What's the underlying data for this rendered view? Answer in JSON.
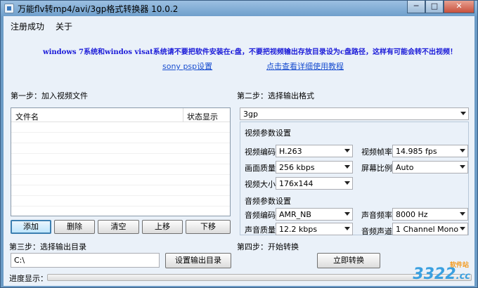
{
  "window": {
    "title": "万能flv转mp4/avi/3gp格式转换器 10.0.2",
    "minimize": "─",
    "maximize": "□",
    "close": "✕"
  },
  "menu": [
    "注册成功",
    "关于"
  ],
  "notice": "windows 7系统和windos visat系统请不要把软件安装在c盘，不要把视频输出存放目录设为c盘路径，这样有可能会转不出视频！",
  "links": {
    "sony": "sony psp设置",
    "help": "点击查看详细使用教程"
  },
  "step1": {
    "title": "第一步：加入视频文件",
    "col_name": "文件名",
    "col_status": "状态显示",
    "buttons": {
      "add": "添加",
      "delete": "删除",
      "clear": "清空",
      "up": "上移",
      "down": "下移"
    }
  },
  "step2": {
    "title": "第二步：选择输出格式",
    "format": "3gp",
    "video": {
      "title": "视频参数设置",
      "codec_label": "视频编码",
      "codec": "H.263",
      "fps_label": "视频帧率",
      "fps": "14.985 fps",
      "quality_label": "画面质量",
      "quality": "256 kbps",
      "ratio_label": "屏幕比例",
      "ratio": "Auto",
      "size_label": "视频大小",
      "size": "176x144"
    },
    "audio": {
      "title": "音频参数设置",
      "codec_label": "音频编码",
      "codec": "AMR_NB",
      "rate_label": "声音频率",
      "rate": "8000 Hz",
      "quality_label": "声音质量",
      "quality": "12.2 kbps",
      "channel_label": "音频声道",
      "channel": "1 Channel Mono"
    }
  },
  "step3": {
    "title": "第三步：选择输出目录",
    "path": "C:\\",
    "button": "设置输出目录"
  },
  "step4": {
    "title": "第四步：开始转换",
    "button": "立即转换"
  },
  "progress": {
    "label": "进度显示：",
    "value": 0
  },
  "watermark": {
    "logo": "3322",
    "suffix": ".cc",
    "tag": "软件站"
  },
  "colors": {
    "link": "#1a4fd0",
    "notice": "#1a1ad8",
    "title_bar": "#7fa9d3",
    "client": "#eaf1f9"
  }
}
